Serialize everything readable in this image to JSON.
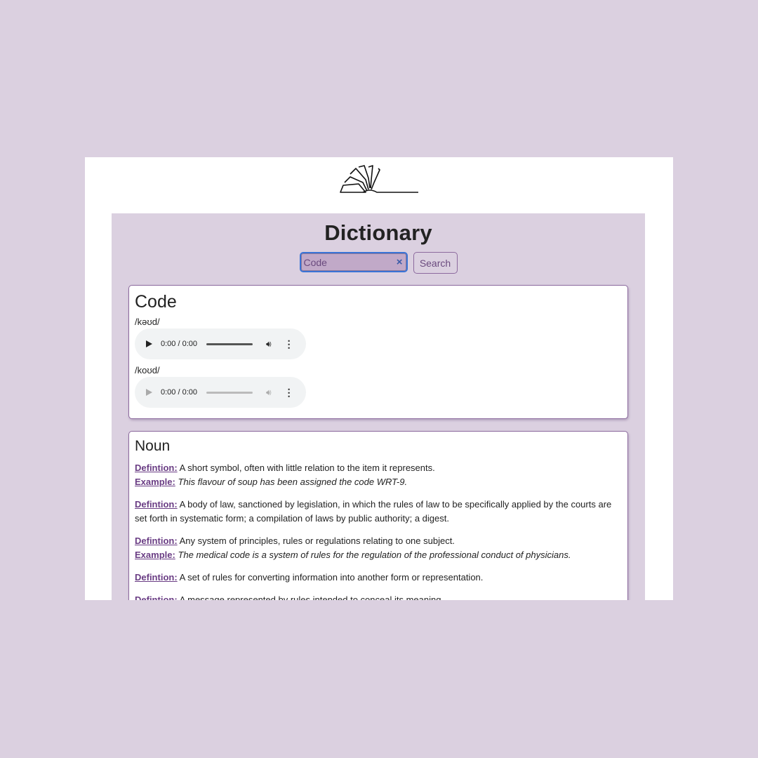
{
  "page": {
    "background": "#dbd0e0",
    "accent": "#6a3d84"
  },
  "logo": {
    "icon": "open-book-icon"
  },
  "app": {
    "title": "Dictionary"
  },
  "search": {
    "value": "Code",
    "clear_icon": "×",
    "button_label": "Search"
  },
  "word": {
    "text": "Code",
    "phonetics": [
      {
        "text": "/kəʊd/",
        "audio": {
          "time": "0:00 / 0:00",
          "enabled": true
        }
      },
      {
        "text": "/koʊd/",
        "audio": {
          "time": "0:00 / 0:00",
          "enabled": false
        }
      }
    ]
  },
  "meaning": {
    "part_of_speech": "Noun",
    "definition_label": "Defintion:",
    "example_label": "Example:",
    "definitions": [
      {
        "definition": "A short symbol, often with little relation to the item it represents.",
        "example": "This flavour of soup has been assigned the code WRT-9."
      },
      {
        "definition": "A body of law, sanctioned by legislation, in which the rules of law to be specifically applied by the courts are set forth in systematic form; a compilation of laws by public authority; a digest."
      },
      {
        "definition": "Any system of principles, rules or regulations relating to one subject.",
        "example": "The medical code is a system of rules for the regulation of the professional conduct of physicians."
      },
      {
        "definition": "A set of rules for converting information into another form or representation."
      },
      {
        "definition": "A message represented by rules intended to conceal its meaning."
      }
    ]
  }
}
